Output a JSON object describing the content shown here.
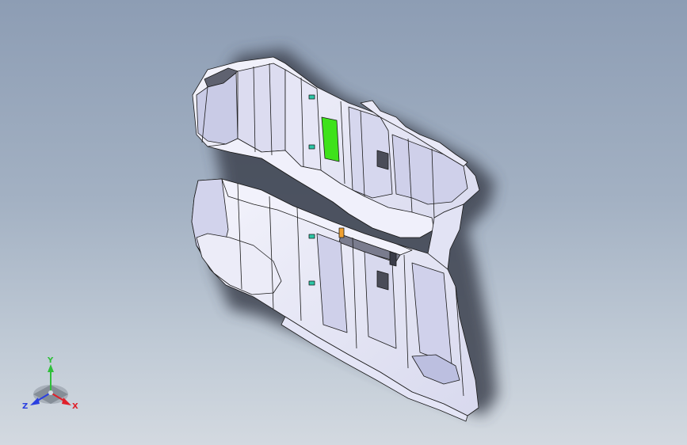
{
  "viewport": {
    "background_top": "#8d9db4",
    "background_bottom": "#d3d9e0"
  },
  "model": {
    "body_color": "#eceef8",
    "shade_color": "#c9cbe6",
    "edge_color": "#1a1a1a",
    "highlight_green": "#3ee21b",
    "highlight_orange": "#f0a030",
    "clip_color": "#2cc6a6"
  },
  "triad": {
    "x_label": "X",
    "y_label": "Y",
    "z_label": "Z",
    "x_color": "#e0202a",
    "y_color": "#2fbf3a",
    "z_color": "#2a3fe0"
  }
}
